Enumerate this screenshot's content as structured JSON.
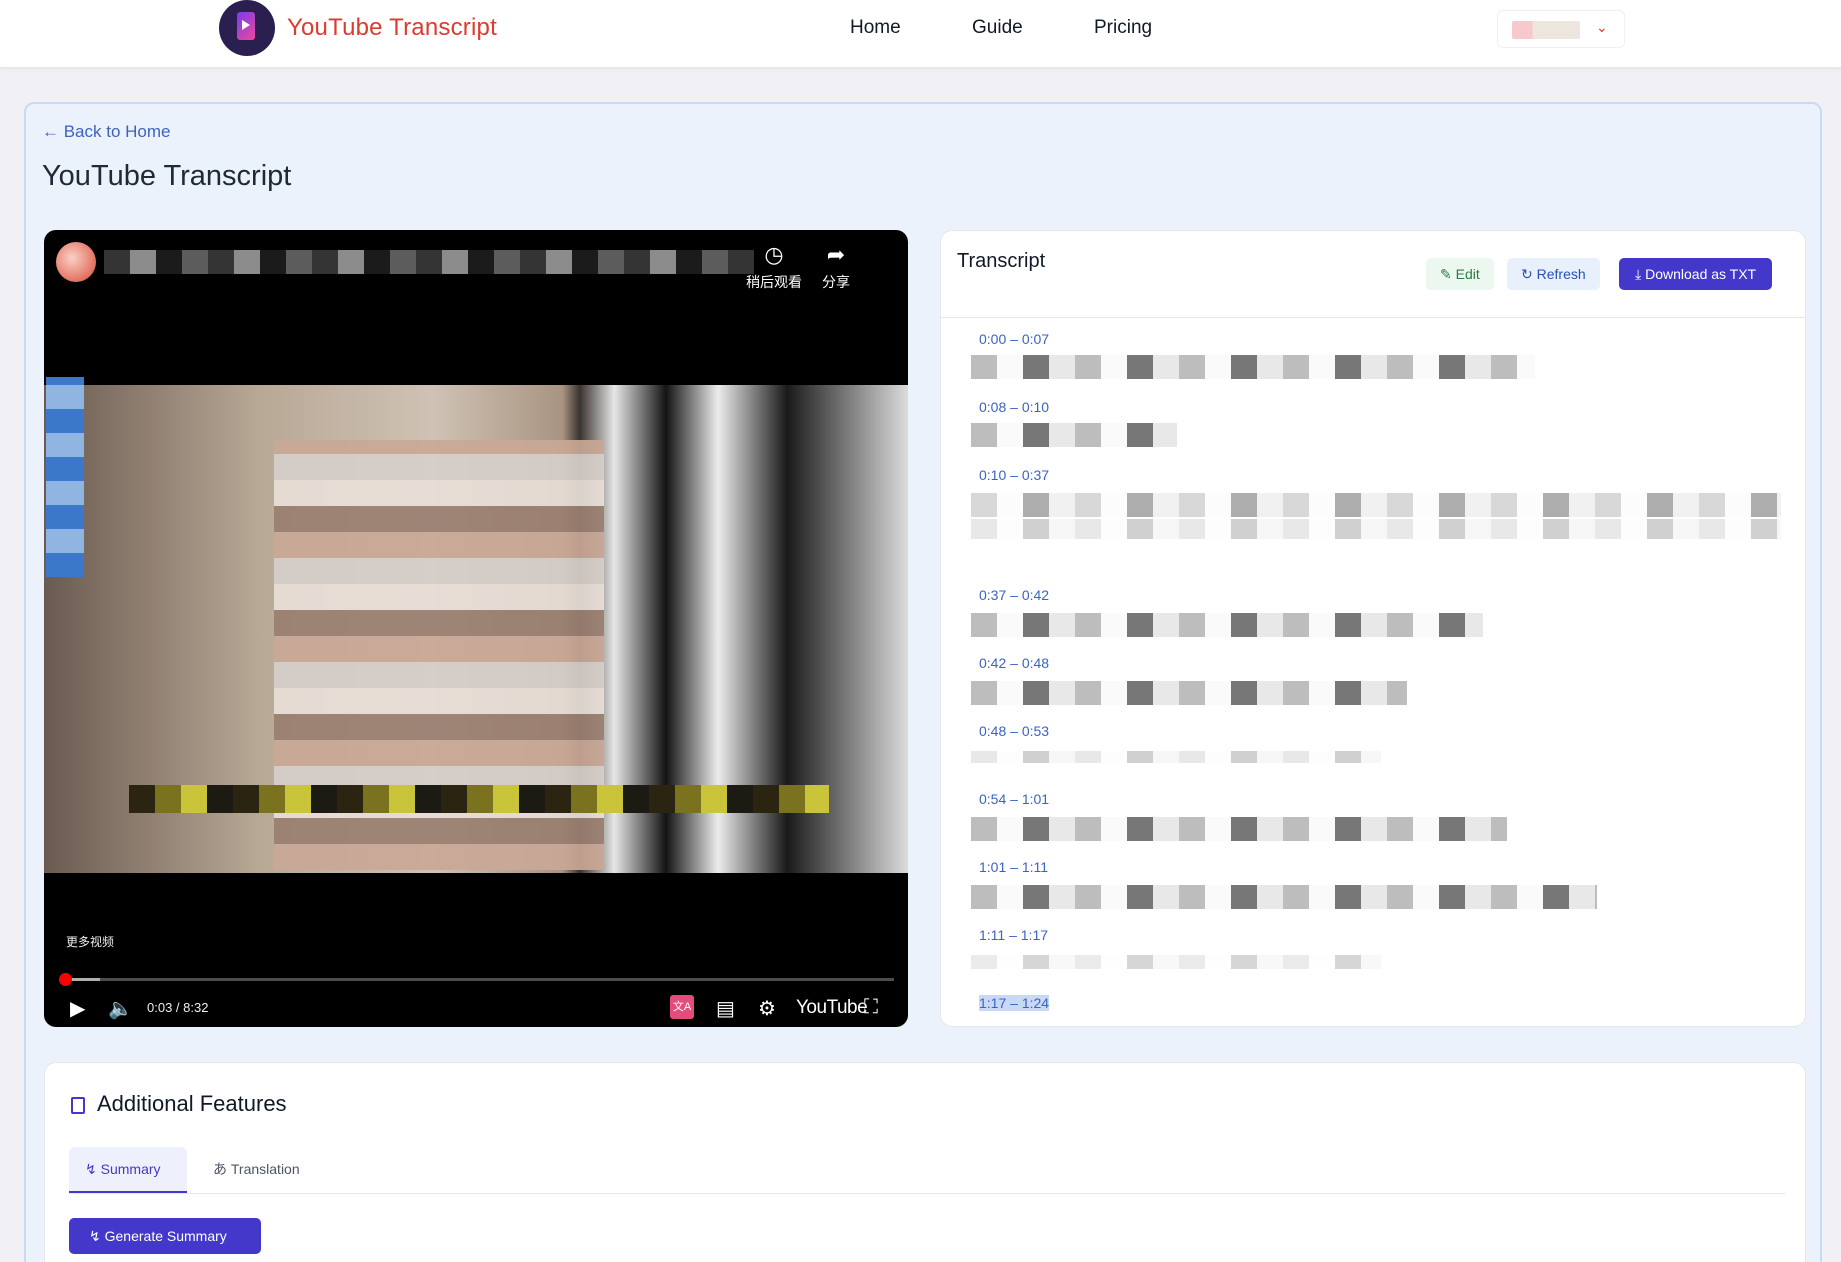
{
  "header": {
    "brand": "YouTube Transcript",
    "nav": [
      "Home",
      "Guide",
      "Pricing"
    ]
  },
  "page": {
    "back_link": "← Back to Home",
    "title": "YouTube Transcript"
  },
  "video": {
    "watch_later": "稍后观看",
    "share": "分享",
    "more_videos": "更多视频",
    "time": "0:03 / 8:32",
    "youtube_logo": "YouTube",
    "progress_fraction": 0.006
  },
  "transcript": {
    "title": "Transcript",
    "edit_label": "Edit",
    "refresh_label": "Refresh",
    "download_label": "Download as TXT",
    "segments": [
      {
        "time": "0:00 – 0:07"
      },
      {
        "time": "0:08 – 0:10"
      },
      {
        "time": "0:10 – 0:37"
      },
      {
        "time": "0:37 – 0:42"
      },
      {
        "time": "0:42 – 0:48"
      },
      {
        "time": "0:48 – 0:53"
      },
      {
        "time": "0:54 – 1:01"
      },
      {
        "time": "1:01 – 1:11"
      },
      {
        "time": "1:11 – 1:17"
      },
      {
        "time": "1:17 – 1:24"
      }
    ]
  },
  "features": {
    "title": "Additional Features",
    "tabs": [
      "Summary",
      "Translation"
    ],
    "generate_label": "Generate Summary"
  },
  "colors": {
    "brand": "#dc3b2e",
    "primary": "#4338ca",
    "link": "#3b63c4"
  }
}
